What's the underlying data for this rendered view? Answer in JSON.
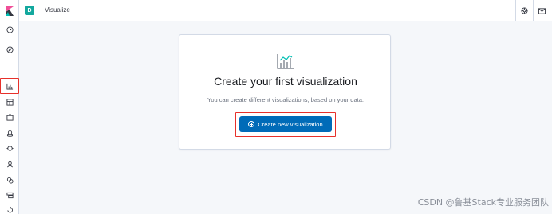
{
  "header": {
    "space_initial": "D",
    "app_title": "Visualize",
    "icons": [
      "help-icon",
      "mail-icon"
    ]
  },
  "sidebar": {
    "items": [
      {
        "name": "recently-viewed-icon"
      },
      {
        "name": "discover-icon"
      },
      {
        "name": "visualize-icon",
        "selected": true
      },
      {
        "name": "dashboard-icon"
      },
      {
        "name": "canvas-icon"
      },
      {
        "name": "maps-icon"
      },
      {
        "name": "machine-learning-icon"
      },
      {
        "name": "infrastructure-icon"
      },
      {
        "name": "logs-icon"
      },
      {
        "name": "apm-icon"
      },
      {
        "name": "uptime-icon"
      },
      {
        "name": "dev-tools-icon"
      },
      {
        "name": "monitoring-icon"
      }
    ]
  },
  "empty_state": {
    "title": "Create your first visualization",
    "body": "You can create different visualizations, based on your data.",
    "button_label": "Create new visualization"
  },
  "watermark": "CSDN @鲁基Stack专业服务团队",
  "colors": {
    "primary": "#006bb8",
    "highlight": "#e7302a",
    "space_badge": "#13a89e"
  }
}
